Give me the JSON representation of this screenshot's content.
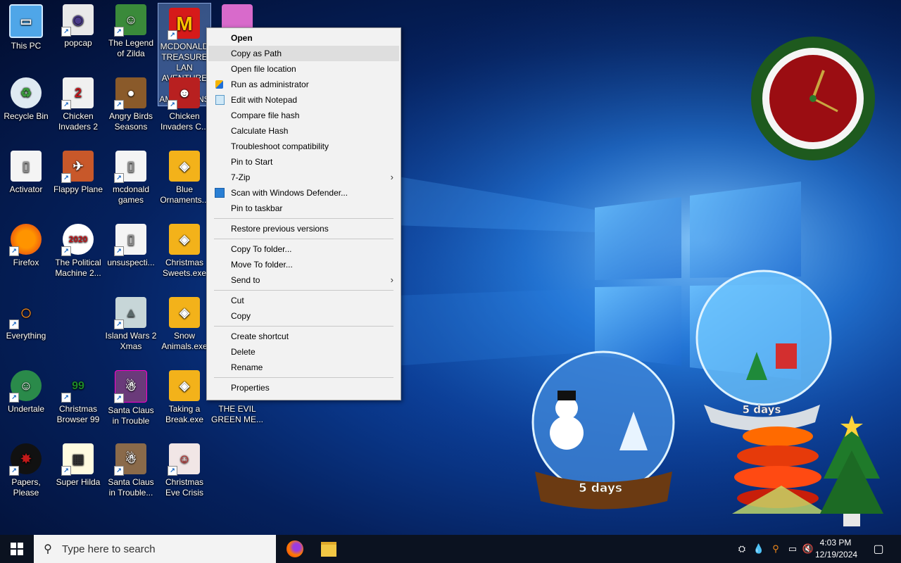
{
  "desktop": {
    "icons": [
      {
        "label": "This PC"
      },
      {
        "label": "popcap"
      },
      {
        "label": "The Legend of Zilda"
      },
      {
        "label": "MCDONALD TREASURE LAN AVENTURE FOR AMERICANS"
      },
      {
        "label": "Recycle Bin"
      },
      {
        "label": "Chicken Invaders 2"
      },
      {
        "label": "Angry Birds Seasons"
      },
      {
        "label": "Chicken Invaders C..."
      },
      {
        "label": "Activator"
      },
      {
        "label": "Flappy Plane"
      },
      {
        "label": "mcdonald games"
      },
      {
        "label": "Blue Ornaments..."
      },
      {
        "label": "Firefox"
      },
      {
        "label": "The Political Machine 2..."
      },
      {
        "label": "unsuspecti..."
      },
      {
        "label": "Christmas Sweets.exe"
      },
      {
        "label": "Everything"
      },
      {
        "label": "Island Wars 2 Xmas"
      },
      {
        "label": "Snow Animals.exe"
      },
      {
        "label": "Undertale"
      },
      {
        "label": "Christmas Browser 99"
      },
      {
        "label": "Santa Claus in Trouble"
      },
      {
        "label": "Taking a Break.exe"
      },
      {
        "label": "THE EVIL GREEN ME..."
      },
      {
        "label": "Papers, Please"
      },
      {
        "label": "Super Hilda"
      },
      {
        "label": "Santa Claus in Trouble..."
      },
      {
        "label": "Christmas Eve Crisis"
      }
    ],
    "badges": {
      "chicken2": "2",
      "political": "2020",
      "browser": "99"
    },
    "globes": {
      "left_label": "5 days",
      "right_label": "5 days"
    }
  },
  "context_menu": {
    "items": [
      {
        "label": "Open"
      },
      {
        "label": "Copy as Path"
      },
      {
        "label": "Open file location"
      },
      {
        "label": "Run as administrator"
      },
      {
        "label": "Edit with Notepad"
      },
      {
        "label": "Compare file hash"
      },
      {
        "label": "Calculate Hash"
      },
      {
        "label": "Troubleshoot compatibility"
      },
      {
        "label": "Pin to Start"
      },
      {
        "label": "7-Zip"
      },
      {
        "label": "Scan with Windows Defender..."
      },
      {
        "label": "Pin to taskbar"
      },
      {
        "label": "Restore previous versions"
      },
      {
        "label": "Copy To folder..."
      },
      {
        "label": "Move To folder..."
      },
      {
        "label": "Send to"
      },
      {
        "label": "Cut"
      },
      {
        "label": "Copy"
      },
      {
        "label": "Create shortcut"
      },
      {
        "label": "Delete"
      },
      {
        "label": "Rename"
      },
      {
        "label": "Properties"
      }
    ],
    "submenu_arrow": "›"
  },
  "taskbar": {
    "search_placeholder": "Type here to search",
    "time": "4:03 PM",
    "date": "12/19/2024"
  },
  "icons": {
    "start": "windows-logo-icon",
    "search": "search-icon",
    "firefox": "firefox-icon",
    "explorer": "folder-icon",
    "notification": "notification-icon"
  },
  "colors": {
    "desktop_bg": "#05215e",
    "taskbar": "#0b1220",
    "menu_bg": "#f2f2f2",
    "menu_hover": "#dedede"
  }
}
